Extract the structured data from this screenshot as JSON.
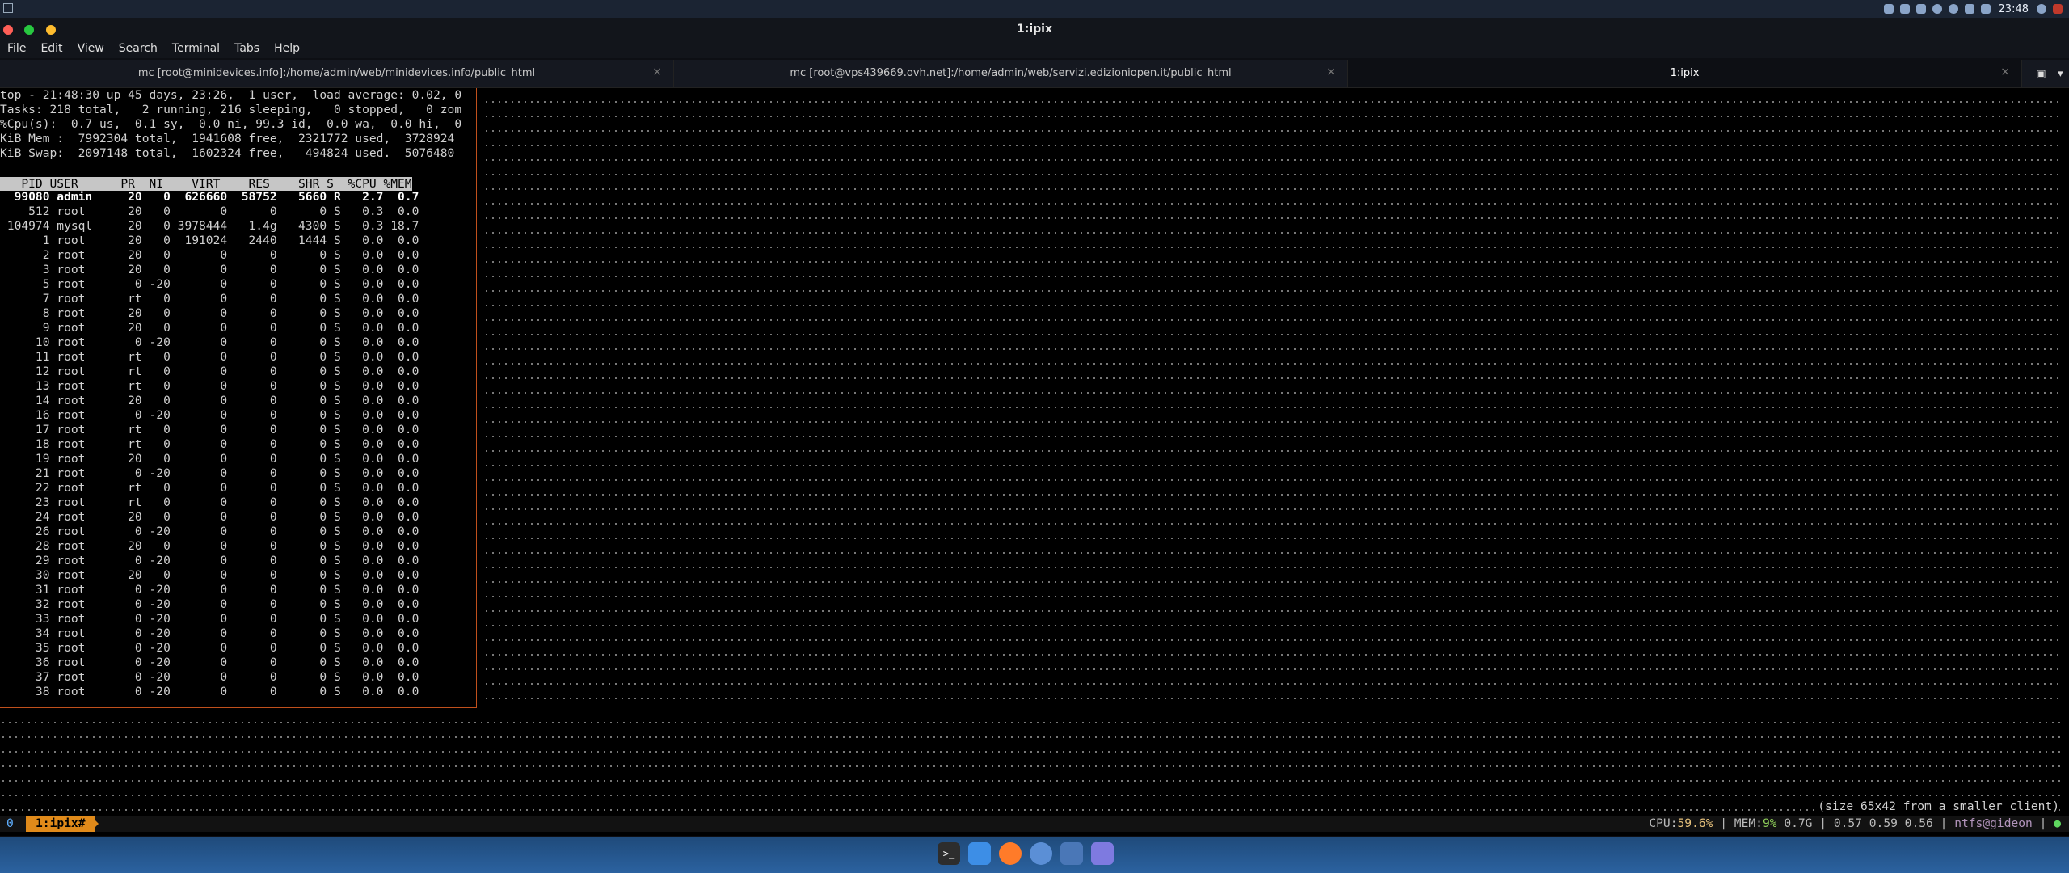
{
  "system_panel": {
    "clock": "23:48"
  },
  "window": {
    "title": "1:ipix"
  },
  "menu": [
    "File",
    "Edit",
    "View",
    "Search",
    "Terminal",
    "Tabs",
    "Help"
  ],
  "tabs": [
    {
      "label": "mc [root@minidevices.info]:/home/admin/web/minidevices.info/public_html",
      "close": "×"
    },
    {
      "label": "mc [root@vps439669.ovh.net]:/home/admin/web/servizi.edizioniopen.it/public_html",
      "close": "×"
    },
    {
      "label": "1:ipix",
      "close": "×"
    }
  ],
  "top": {
    "summary": [
      "top - 21:48:30 up 45 days, 23:26,  1 user,  load average: 0.02, 0",
      "Tasks: 218 total,   2 running, 216 sleeping,   0 stopped,   0 zom",
      "%Cpu(s):  0.7 us,  0.1 sy,  0.0 ni, 99.3 id,  0.0 wa,  0.0 hi,  0",
      "KiB Mem :  7992304 total,  1941608 free,  2321772 used,  3728924",
      "KiB Swap:  2097148 total,  1602324 free,   494824 used.  5076480"
    ],
    "header": "   PID USER      PR  NI    VIRT    RES    SHR S  %CPU %MEM",
    "processes": [
      "  99080 admin     20   0  626660  58752   5660 R   2.7  0.7",
      "    512 root      20   0       0      0      0 S   0.3  0.0",
      " 104974 mysql     20   0 3978444   1.4g   4300 S   0.3 18.7",
      "      1 root      20   0  191024   2440   1444 S   0.0  0.0",
      "      2 root      20   0       0      0      0 S   0.0  0.0",
      "      3 root      20   0       0      0      0 S   0.0  0.0",
      "      5 root       0 -20       0      0      0 S   0.0  0.0",
      "      7 root      rt   0       0      0      0 S   0.0  0.0",
      "      8 root      20   0       0      0      0 S   0.0  0.0",
      "      9 root      20   0       0      0      0 S   0.0  0.0",
      "     10 root       0 -20       0      0      0 S   0.0  0.0",
      "     11 root      rt   0       0      0      0 S   0.0  0.0",
      "     12 root      rt   0       0      0      0 S   0.0  0.0",
      "     13 root      rt   0       0      0      0 S   0.0  0.0",
      "     14 root      20   0       0      0      0 S   0.0  0.0",
      "     16 root       0 -20       0      0      0 S   0.0  0.0",
      "     17 root      rt   0       0      0      0 S   0.0  0.0",
      "     18 root      rt   0       0      0      0 S   0.0  0.0",
      "     19 root      20   0       0      0      0 S   0.0  0.0",
      "     21 root       0 -20       0      0      0 S   0.0  0.0",
      "     22 root      rt   0       0      0      0 S   0.0  0.0",
      "     23 root      rt   0       0      0      0 S   0.0  0.0",
      "     24 root      20   0       0      0      0 S   0.0  0.0",
      "     26 root       0 -20       0      0      0 S   0.0  0.0",
      "     28 root      20   0       0      0      0 S   0.0  0.0",
      "     29 root       0 -20       0      0      0 S   0.0  0.0",
      "     30 root      20   0       0      0      0 S   0.0  0.0",
      "     31 root       0 -20       0      0      0 S   0.0  0.0",
      "     32 root       0 -20       0      0      0 S   0.0  0.0",
      "     33 root       0 -20       0      0      0 S   0.0  0.0",
      "     34 root       0 -20       0      0      0 S   0.0  0.0",
      "     35 root       0 -20       0      0      0 S   0.0  0.0",
      "     36 root       0 -20       0      0      0 S   0.0  0.0",
      "     37 root       0 -20       0      0      0 S   0.0  0.0",
      "     38 root       0 -20       0      0      0 S   0.0  0.0"
    ]
  },
  "size_note": "(size 65x42 from a smaller client)",
  "tmux": {
    "session": "0",
    "window": "1:ipix#",
    "cpu_label": "CPU:",
    "cpu_value": "59.6%",
    "mem_label": " | MEM:",
    "mem_value": "9%",
    "mem_rest": " 0.7G | 0.57 0.59 0.56 | ",
    "host": "ntfs@gideon",
    "tail": " | ",
    "dot": "●"
  },
  "dock": {
    "terminal_glyph": ">_"
  }
}
